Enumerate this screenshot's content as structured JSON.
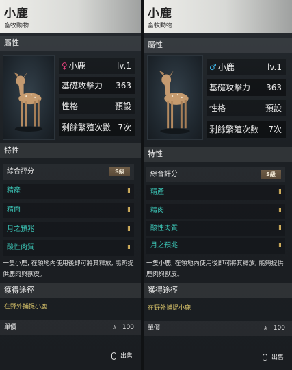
{
  "panels": [
    {
      "title": "小鹿",
      "category": "畜牧動物",
      "attributes_header": "屬性",
      "gender_symbol": "♀",
      "gender_color": "#e0407a",
      "stats": [
        {
          "label": "小鹿",
          "value": "lv.1"
        },
        {
          "label": "基礎攻擊力",
          "value": "363"
        },
        {
          "label": "性格",
          "value": "預設"
        },
        {
          "label": "剩餘繁殖次數",
          "value": "7次"
        }
      ],
      "traits_header": "特性",
      "overall_label": "綜合評分",
      "overall_grade": "S級",
      "traits": [
        {
          "name": "精產",
          "tier": "III"
        },
        {
          "name": "精肉",
          "tier": "III"
        },
        {
          "name": "月之預兆",
          "tier": "III"
        },
        {
          "name": "酸性肉質",
          "tier": "III"
        }
      ],
      "description": "一隻小鹿, 在領地內使用後即可將其釋放, 能夠提供鹿肉與獸皮。",
      "obtain_header": "獲得途徑",
      "obtain_text": "在野外捕捉小鹿",
      "price_label": "單價",
      "price_icon": "⩓",
      "price_value": "100",
      "sell_label": "出售"
    },
    {
      "title": "小鹿",
      "category": "畜牧動物",
      "attributes_header": "屬性",
      "gender_symbol": "♂",
      "gender_color": "#3fb4e6",
      "stats": [
        {
          "label": "小鹿",
          "value": "lv.1"
        },
        {
          "label": "基礎攻擊力",
          "value": "363"
        },
        {
          "label": "性格",
          "value": "預設"
        },
        {
          "label": "剩餘繁殖次數",
          "value": "7次"
        }
      ],
      "traits_header": "特性",
      "overall_label": "綜合評分",
      "overall_grade": "S級",
      "traits": [
        {
          "name": "精產",
          "tier": "III"
        },
        {
          "name": "精肉",
          "tier": "III"
        },
        {
          "name": "酸性肉質",
          "tier": "III"
        },
        {
          "name": "月之預兆",
          "tier": "III"
        }
      ],
      "description": "一隻小鹿, 在領地內使用後即可將其釋放, 能夠提供鹿肉與獸皮。",
      "obtain_header": "獲得途徑",
      "obtain_text": "在野外捕捉小鹿",
      "price_label": "單價",
      "price_icon": "⩓",
      "price_value": "100",
      "sell_label": "出售"
    }
  ]
}
